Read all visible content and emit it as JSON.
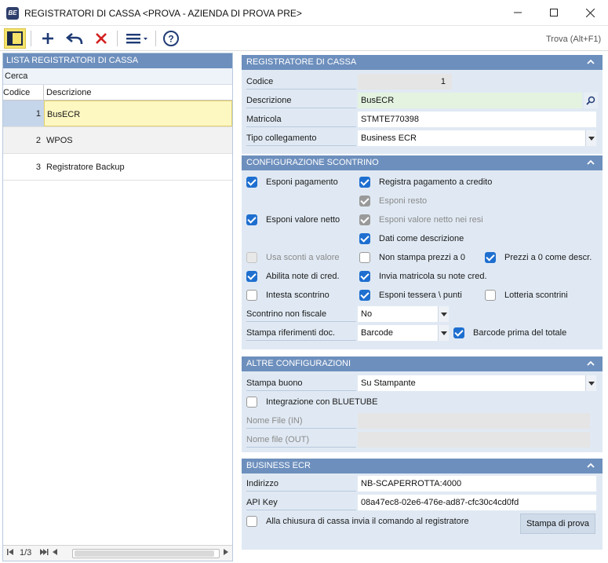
{
  "window": {
    "title": "REGISTRATORI DI CASSA <PROVA - AZIENDA DI PROVA PRE>",
    "app_icon_text": "BE"
  },
  "toolbar": {
    "find_label": "Trova (Alt+F1)",
    "icons": [
      "panel-toggle-icon",
      "add-icon",
      "undo-icon",
      "delete-icon",
      "menu-icon",
      "help-icon"
    ]
  },
  "list": {
    "header": "LISTA REGISTRATORI DI CASSA",
    "search_label": "Cerca",
    "columns": [
      "Codice",
      "Descrizione"
    ],
    "rows": [
      {
        "code": "1",
        "desc": "BusECR"
      },
      {
        "code": "2",
        "desc": "WPOS"
      },
      {
        "code": "3",
        "desc": "Registratore Backup"
      }
    ],
    "pager": "1/3"
  },
  "registratore": {
    "header": "REGISTRATORE DI CASSA",
    "codice_label": "Codice",
    "codice_value": "1",
    "descrizione_label": "Descrizione",
    "descrizione_value": "BusECR",
    "matricola_label": "Matricola",
    "matricola_value": "STMTE770398",
    "tipo_label": "Tipo collegamento",
    "tipo_value": "Business ECR"
  },
  "scontrino": {
    "header": "CONFIGURAZIONE SCONTRINO",
    "esponi_pagamento": "Esponi pagamento",
    "registra_pagamento": "Registra pagamento a credito",
    "esponi_resto": "Esponi resto",
    "esponi_valore_netto": "Esponi valore netto",
    "esponi_valore_netto_resi": "Esponi valore netto nei resi",
    "dati_descrizione": "Dati come descrizione",
    "usa_sconti": "Usa sconti a valore",
    "non_stampa_prezzi": "Non stampa prezzi a 0",
    "prezzi_zero": "Prezzi a 0 come descr.",
    "abilita_note": "Abilita note di cred.",
    "invia_matricola": "Invia matricola su note cred.",
    "intesta": "Intesta scontrino",
    "esponi_tessera": "Esponi tessera \\ punti",
    "lotteria": "Lotteria scontrini",
    "non_fiscale_label": "Scontrino non fiscale",
    "non_fiscale_value": "No",
    "riferimenti_label": "Stampa riferimenti doc.",
    "riferimenti_value": "Barcode",
    "barcode_prima": "Barcode prima del totale"
  },
  "altre": {
    "header": "ALTRE CONFIGURAZIONI",
    "buono_label": "Stampa buono",
    "buono_value": "Su Stampante",
    "bluetube": "Integrazione con BLUETUBE",
    "file_in": "Nome File (IN)",
    "file_out": "Nome file (OUT)"
  },
  "business": {
    "header": "BUSINESS ECR",
    "indirizzo_label": "Indirizzo",
    "indirizzo_value": "NB-SCAPERROTTA:4000",
    "apikey_label": "API Key",
    "apikey_value": "08a47ec8-02e6-476e-ad87-cfc30c4cd0fd",
    "chiusura": "Alla chiusura di cassa invia il comando al registratore",
    "stampa_prova": "Stampa di prova"
  },
  "colors": {
    "accent": "#6d8fbd",
    "checkbox": "#1e6fd0",
    "section_bg": "#e0e9f3"
  }
}
